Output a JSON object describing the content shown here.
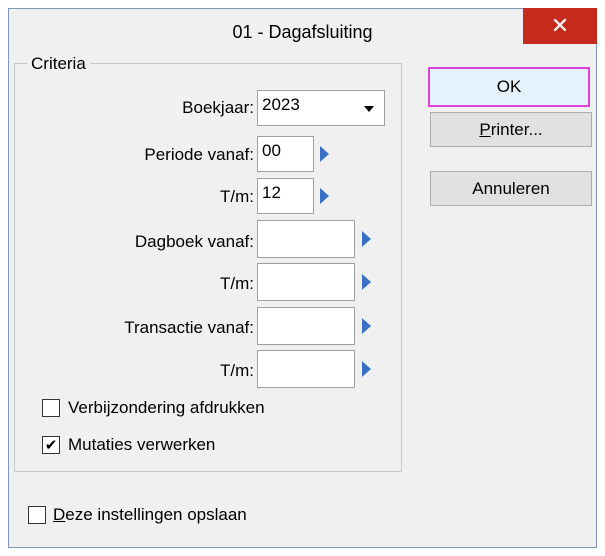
{
  "window": {
    "title": "01 - Dagafsluiting",
    "close_glyph": "✕"
  },
  "criteria": {
    "legend": "Criteria",
    "boekjaar": {
      "label": "Boekjaar:",
      "value": "2023"
    },
    "periode_vanaf": {
      "label": "Periode vanaf:",
      "value": "00"
    },
    "periode_tm": {
      "label": "T/m:",
      "value": "12"
    },
    "dagboek_vanaf": {
      "label": "Dagboek vanaf:",
      "value": ""
    },
    "dagboek_tm": {
      "label": "T/m:",
      "value": ""
    },
    "transactie_vanaf": {
      "label": "Transactie vanaf:",
      "value": ""
    },
    "transactie_tm": {
      "label": "T/m:",
      "value": ""
    },
    "verbijzondering": {
      "label": "Verbijzondering afdrukken",
      "checked": false
    },
    "mutaties": {
      "label": "Mutaties verwerken",
      "checked": true,
      "check_glyph": "✔"
    }
  },
  "buttons": {
    "ok": "OK",
    "printer_u": "P",
    "printer_rest": "rinter...",
    "annuleren": "Annuleren"
  },
  "save_settings": {
    "label_u": "D",
    "label_rest": "eze instellingen opslaan",
    "checked": false
  },
  "colors": {
    "close_red": "#c42b1c",
    "arrow_blue": "#3a6fc7",
    "default_button_border": "#e040e0"
  }
}
